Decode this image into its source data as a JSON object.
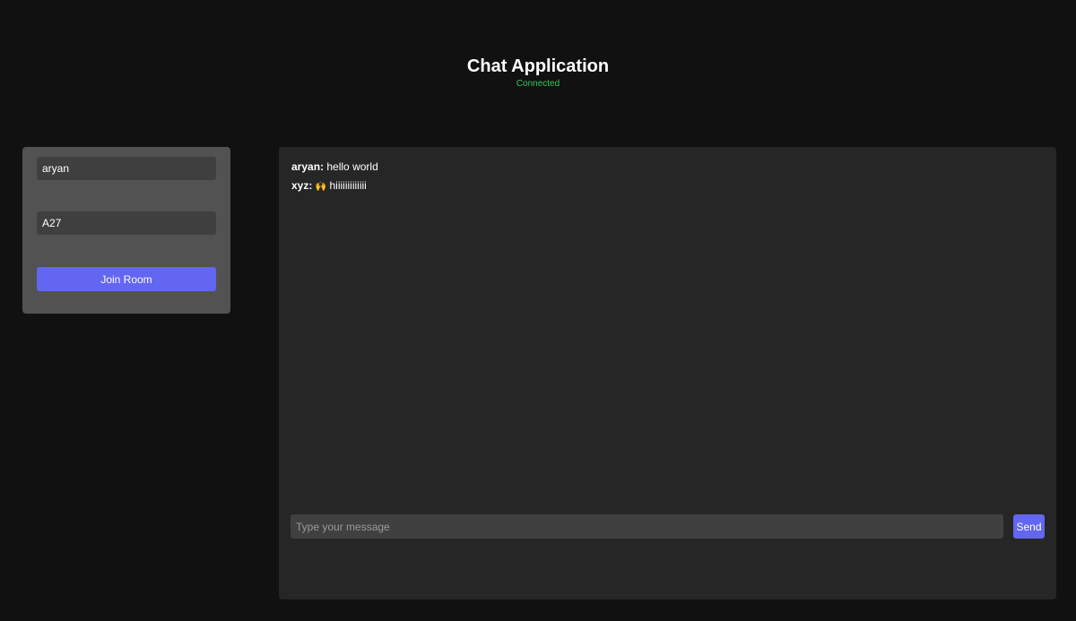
{
  "header": {
    "title": "Chat Application",
    "status": "Connected",
    "status_color": "#35c759"
  },
  "join_panel": {
    "username_value": "aryan",
    "room_value": "A27",
    "join_label": "Join Room",
    "accent_color": "#6366f1"
  },
  "chat": {
    "messages": [
      {
        "user": "aryan:",
        "emoji": "",
        "text": "hello world"
      },
      {
        "user": "xyz:",
        "emoji": "🙌",
        "text": "hiiiiiiiiiiiii"
      }
    ],
    "input_placeholder": "Type your message",
    "send_label": "Send"
  }
}
